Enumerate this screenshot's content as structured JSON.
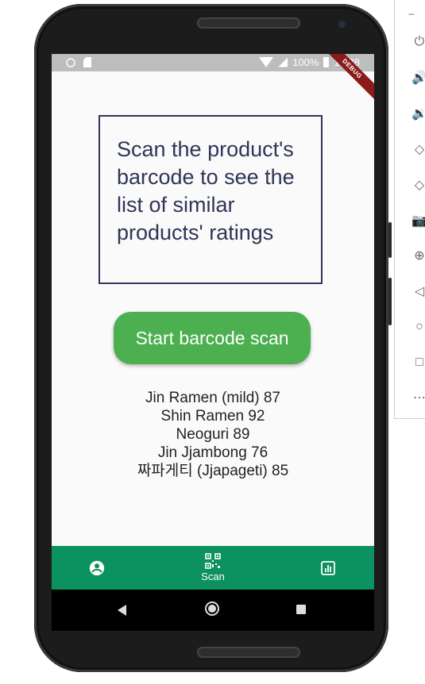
{
  "status_bar": {
    "battery": "100%",
    "time": "10:38",
    "debug_banner": "DEBUG"
  },
  "main": {
    "prompt_text": "Scan the product's barcode to see the list of similar products' ratings",
    "scan_button_label": "Start barcode scan",
    "ratings": [
      "Jin Ramen (mild) 87",
      "Shin Ramen 92",
      "Neoguri 89",
      "Jin Jjambong 76",
      "짜파게티 (Jjapageti) 85"
    ]
  },
  "bottom_nav": {
    "items": [
      {
        "icon": "account-circle-icon",
        "label": ""
      },
      {
        "icon": "qr-code-icon",
        "label": "Scan"
      },
      {
        "icon": "chart-icon",
        "label": ""
      }
    ]
  },
  "colors": {
    "accent_green": "#4caf50",
    "nav_green": "#0c9160",
    "text_navy": "#2f3557"
  },
  "emulator_toolbar": {
    "minimize": "–",
    "tools": [
      "power-icon",
      "volume-up-icon",
      "volume-down-icon",
      "rotate-left-icon",
      "rotate-right-icon",
      "camera-icon",
      "zoom-icon",
      "back-icon",
      "home-icon",
      "overview-icon",
      "more-icon"
    ]
  }
}
